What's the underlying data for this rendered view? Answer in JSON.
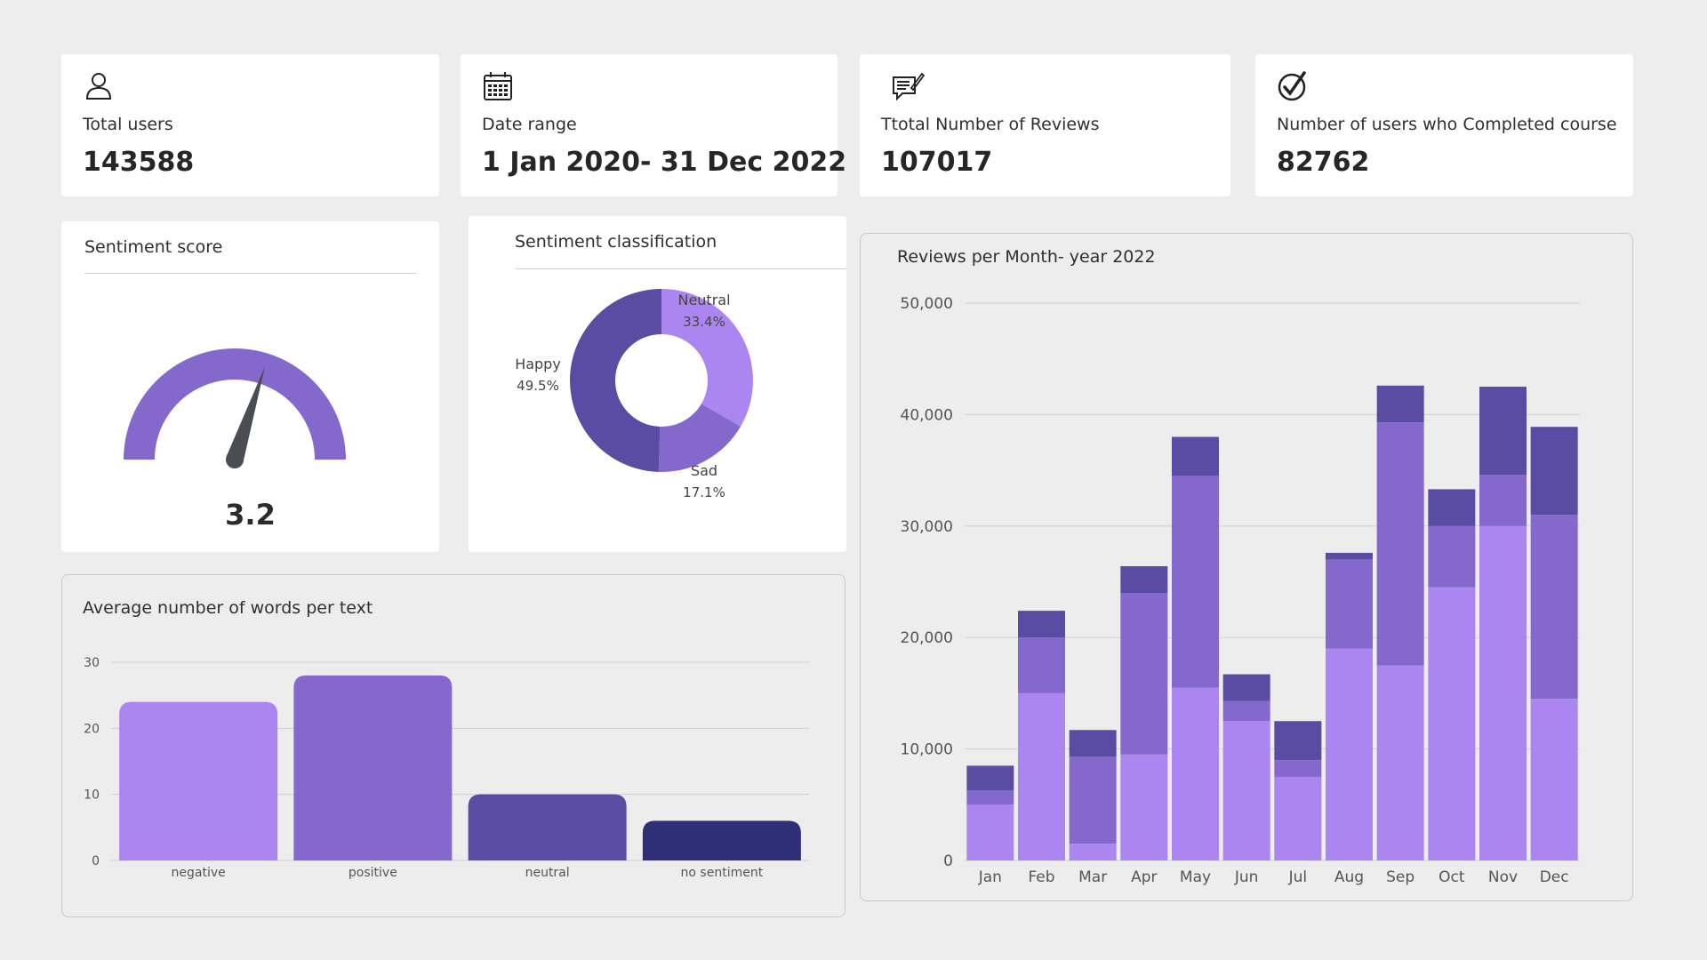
{
  "kpis": [
    {
      "icon": "user-icon",
      "label": "Total users",
      "value": "143588"
    },
    {
      "icon": "calendar-icon",
      "label": "Date range",
      "value": "1 Jan 2020- 31 Dec 2022"
    },
    {
      "icon": "review-icon",
      "label": "Ttotal Number of Reviews",
      "value": "107017"
    },
    {
      "icon": "check-circle-icon",
      "label": "Number of users who Completed course",
      "value": "82762"
    }
  ],
  "sentiment_score": {
    "title": "Sentiment score",
    "value": "3.2",
    "gauge_fraction": 0.6
  },
  "colors": {
    "light": "#ab86f0",
    "mid": "#8468cc",
    "dark": "#5a4ba3",
    "darkest": "#2f2f78",
    "needle": "#4a4d52"
  },
  "sentiment_classification": {
    "title": "Sentiment classification",
    "slices": [
      {
        "name": "Neutral",
        "pct_label": "33.4%",
        "value": 33.4
      },
      {
        "name": "Sad",
        "pct_label": "17.1%",
        "value": 17.1
      },
      {
        "name": "Happy",
        "pct_label": "49.5%",
        "value": 49.5
      }
    ]
  },
  "avg_words": {
    "title": "Average number of words per text"
  },
  "reviews_per_month": {
    "title": "Reviews per Month- year 2022"
  },
  "chart_data": [
    {
      "type": "pie",
      "title": "Sentiment classification",
      "categories": [
        "Neutral",
        "Sad",
        "Happy"
      ],
      "values": [
        33.4,
        17.1,
        49.5
      ]
    },
    {
      "type": "bar",
      "title": "Average number of words per text",
      "categories": [
        "negative",
        "positive",
        "neutral",
        "no sentiment"
      ],
      "values": [
        24,
        28,
        10,
        6
      ],
      "ylim": [
        0,
        30
      ],
      "yticks": [
        "0",
        "10",
        "20",
        "30"
      ],
      "grid": true
    },
    {
      "type": "bar",
      "stacked": true,
      "title": "Reviews per Month- year 2022",
      "categories": [
        "Jan",
        "Feb",
        "Mar",
        "Apr",
        "May",
        "Jun",
        "Jul",
        "Aug",
        "Sep",
        "Oct",
        "Nov",
        "Dec"
      ],
      "series": [
        {
          "values": [
            5000,
            15000,
            1500,
            9500,
            15500,
            12500,
            7500,
            19000,
            17500,
            24500,
            30000,
            14500
          ]
        },
        {
          "values": [
            1300,
            5000,
            7800,
            14500,
            19000,
            1800,
            1500,
            8000,
            21800,
            5500,
            4600,
            16500
          ]
        },
        {
          "values": [
            2200,
            2400,
            2400,
            2400,
            3500,
            2400,
            3500,
            600,
            3300,
            3300,
            7900,
            7900
          ]
        }
      ],
      "ylim": [
        0,
        50000
      ],
      "yticks": [
        "0",
        "10,000",
        "20,000",
        "30,000",
        "40,000",
        "50,000"
      ],
      "grid": true
    }
  ]
}
